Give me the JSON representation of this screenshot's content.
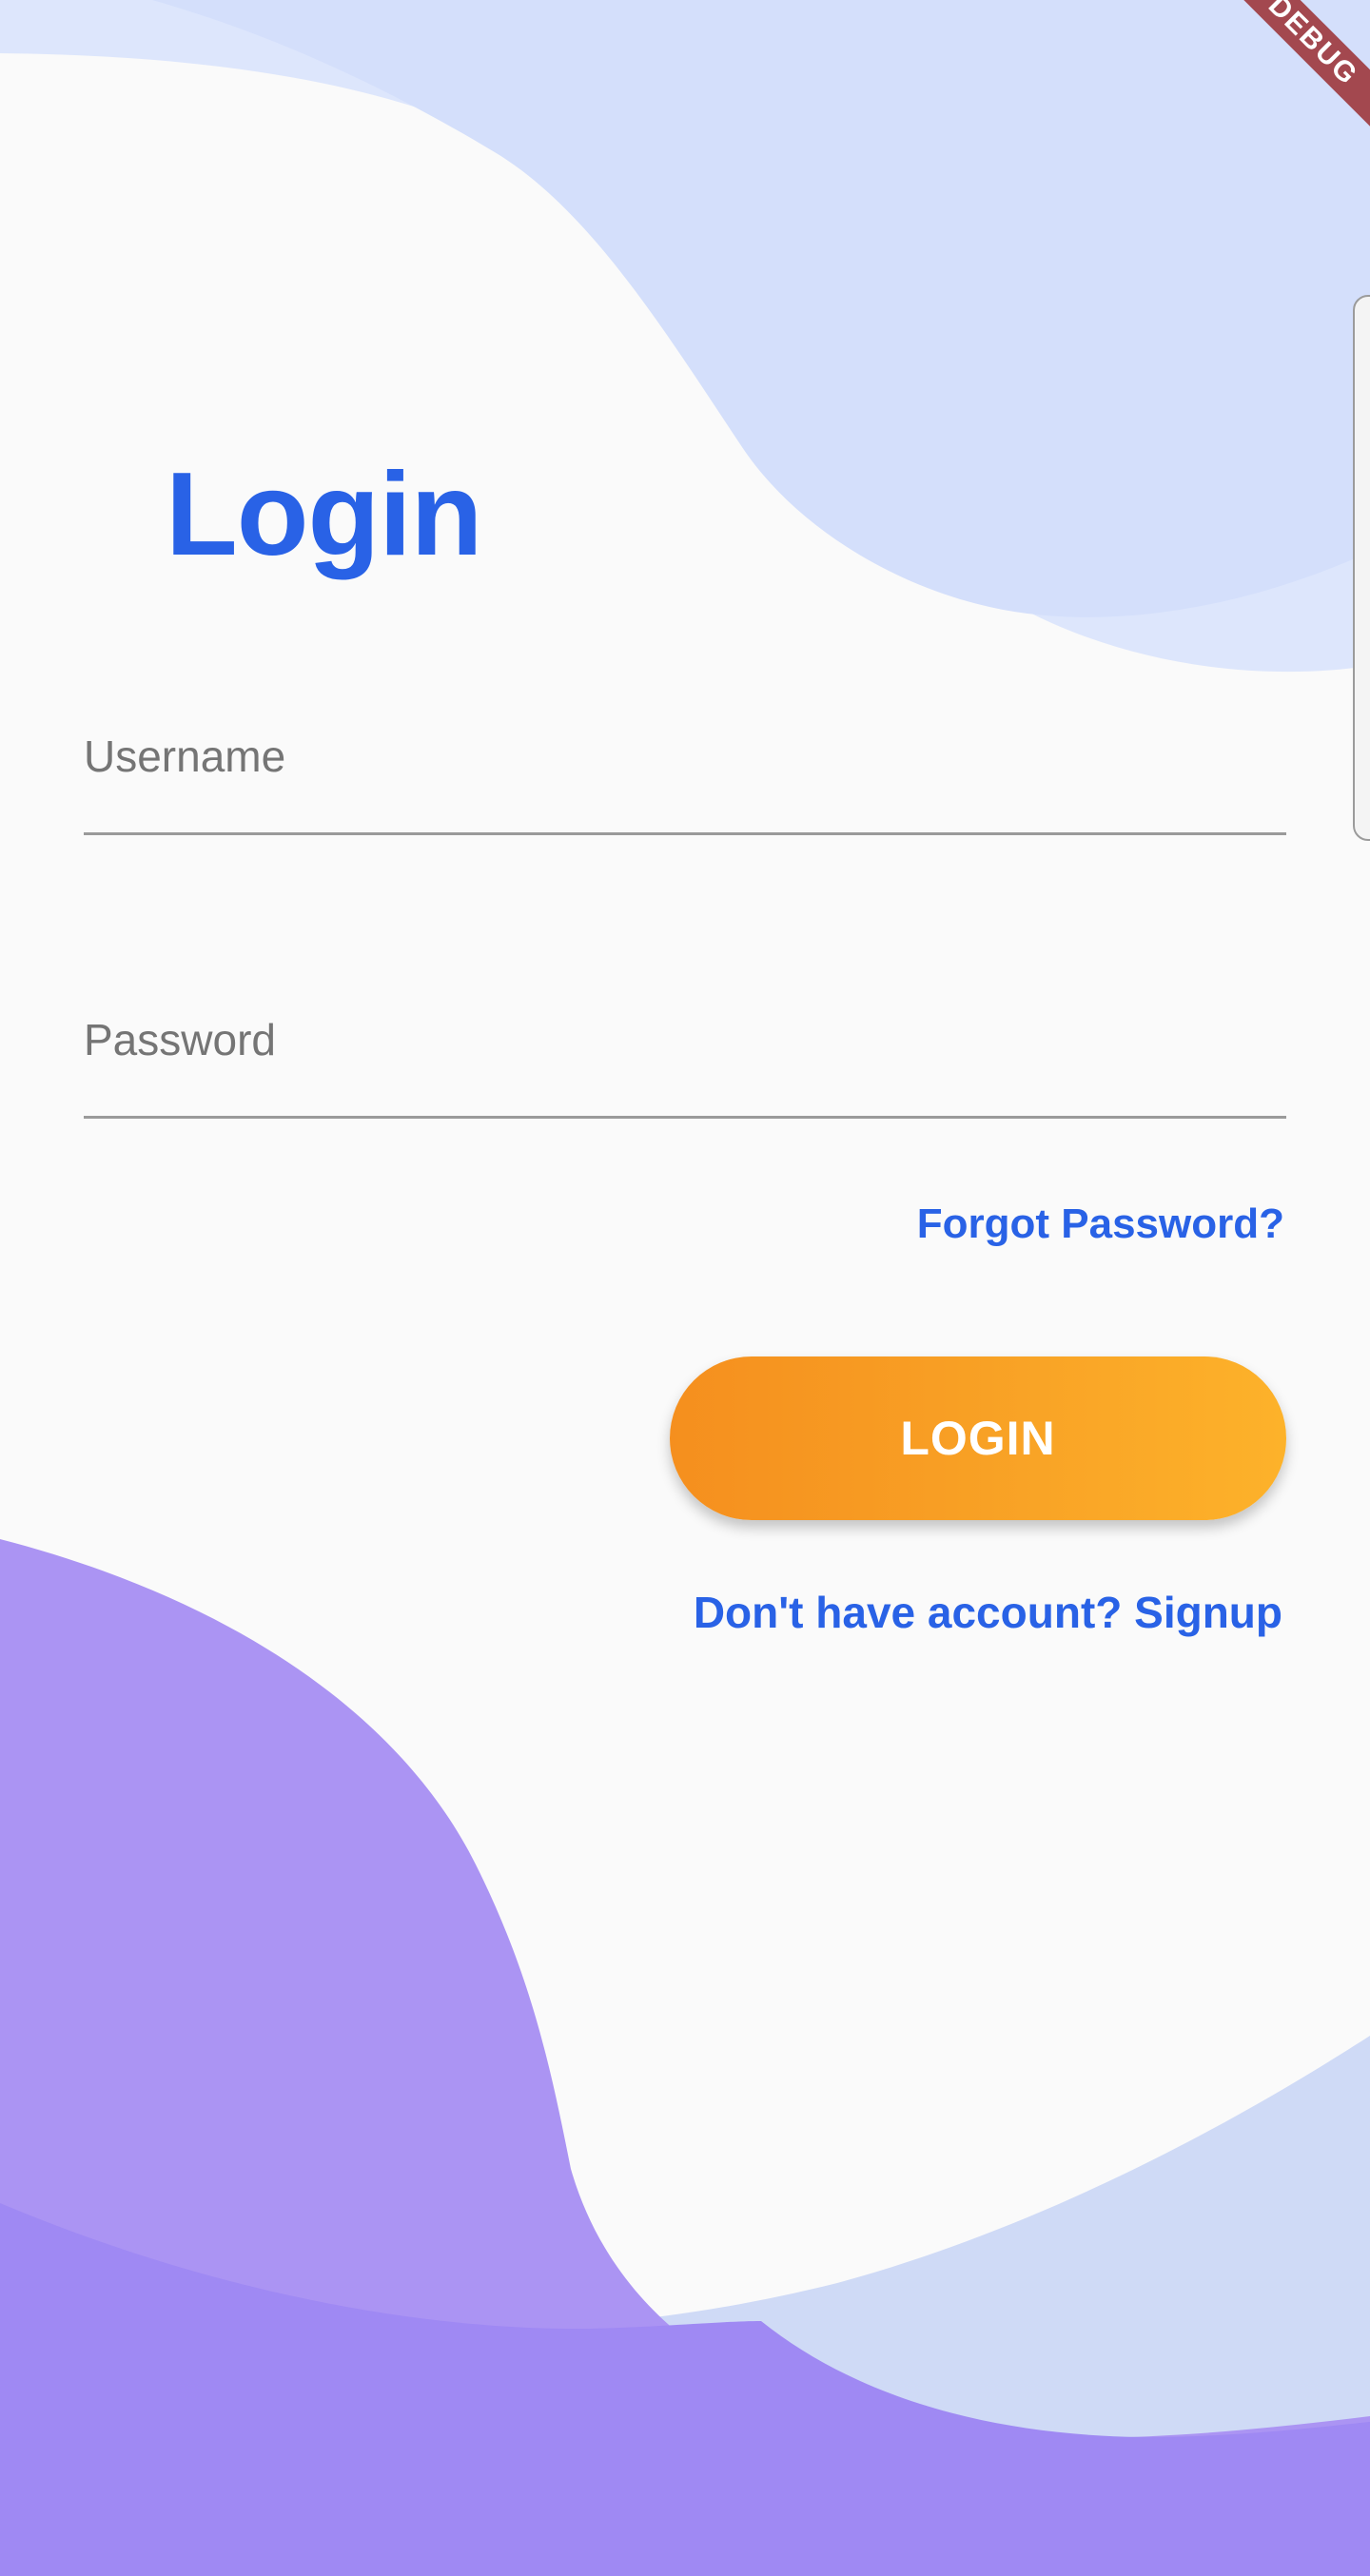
{
  "debug_banner": {
    "label": "DEBUG"
  },
  "login": {
    "title": "Login",
    "username": {
      "placeholder": "Username",
      "value": ""
    },
    "password": {
      "placeholder": "Password",
      "value": ""
    },
    "forgot_password_label": "Forgot Password?",
    "login_button_label": "LOGIN",
    "signup_link_label": "Don't have account? Signup"
  },
  "colors": {
    "background": "#fafafa",
    "accent_blue": "#2962e6",
    "button_gradient_start": "#f58f1e",
    "button_gradient_end": "#fdb22a",
    "top_wave": "#d6e0fb",
    "bottom_wave_light": "#ab94f3",
    "bottom_wave_dark": "#9f89f3",
    "bottom_right_wave": "#cfdaf6"
  }
}
